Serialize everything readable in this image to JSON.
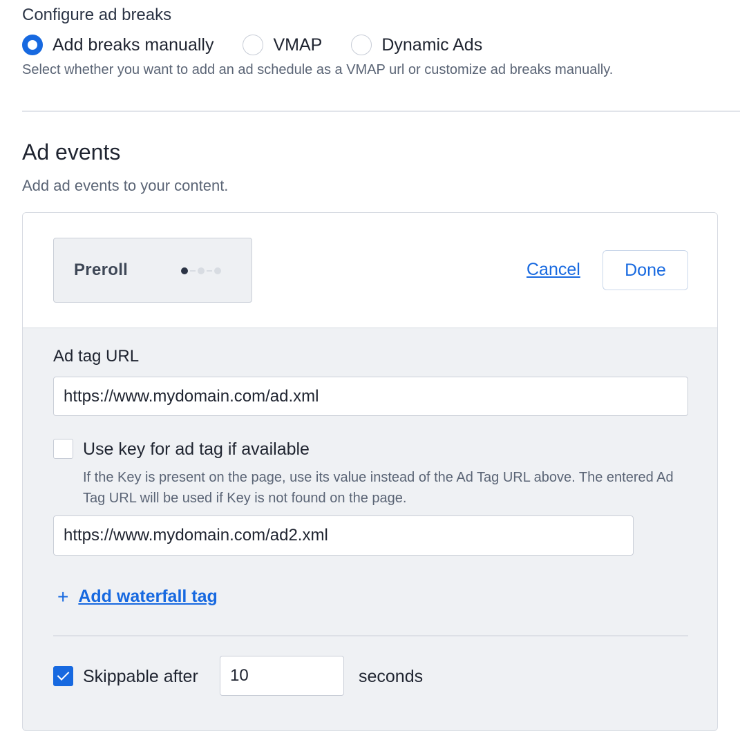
{
  "configure": {
    "label": "Configure ad breaks",
    "options": [
      {
        "label": "Add breaks manually",
        "selected": true
      },
      {
        "label": "VMAP",
        "selected": false
      },
      {
        "label": "Dynamic Ads",
        "selected": false
      }
    ],
    "help": "Select whether you want to add an ad schedule as a VMAP url or customize ad breaks manually."
  },
  "ad_events": {
    "title": "Ad events",
    "subtitle": "Add ad events to your content."
  },
  "editor": {
    "break_name": "Preroll",
    "cancel_label": "Cancel",
    "done_label": "Done",
    "ad_tag_label": "Ad tag URL",
    "ad_tag_value": "https://www.mydomain.com/ad.xml",
    "use_key_label": "Use key for ad tag if available",
    "use_key_checked": false,
    "use_key_help": "If the Key is present on the page, use its value instead of the Ad Tag URL above. The entered Ad Tag URL will be used if Key is not found on the page.",
    "waterfall_value": "https://www.mydomain.com/ad2.xml",
    "add_waterfall_label": "Add waterfall tag",
    "add_waterfall_icon": "+",
    "skippable_label": "Skippable after",
    "skippable_checked": true,
    "skippable_value": "10",
    "seconds_label": "seconds"
  },
  "colors": {
    "accent": "#1769e0",
    "text": "#1f2430",
    "muted": "#5a6475",
    "panel_bg": "#eff1f4"
  }
}
